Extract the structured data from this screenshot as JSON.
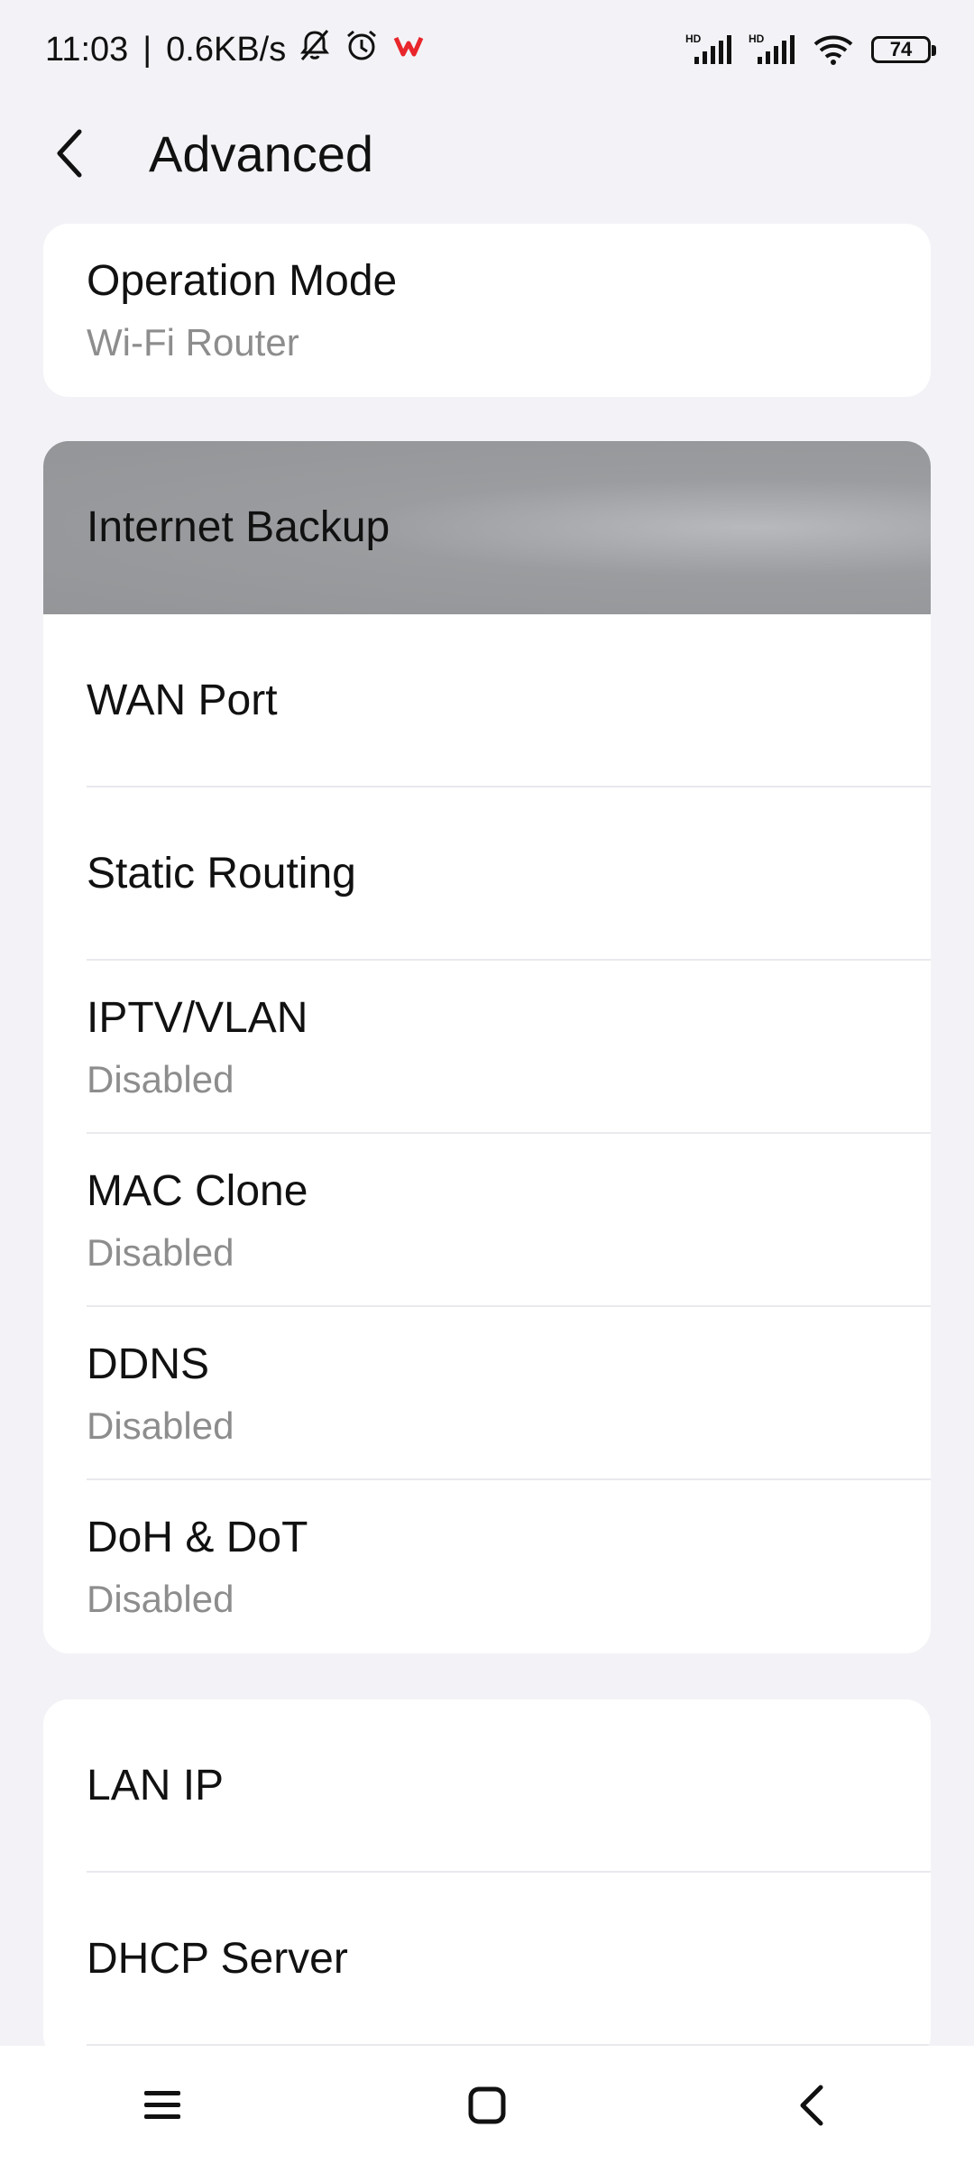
{
  "status_bar": {
    "time": "11:03",
    "separator": "|",
    "net_speed": "0.6KB/s",
    "battery_level": "74",
    "icons": [
      "mute-icon",
      "alarm-icon",
      "wps-app-icon",
      "hd-signal-icon",
      "hd-signal-icon",
      "wifi-icon",
      "battery-icon"
    ]
  },
  "header": {
    "title": "Advanced",
    "back_icon": "chevron-left-icon"
  },
  "cards": [
    {
      "items": [
        {
          "title": "Operation Mode",
          "subtitle": "Wi-Fi Router"
        }
      ]
    },
    {
      "items": [
        {
          "title": "Internet Backup",
          "pressed": true
        },
        {
          "title": "WAN Port"
        },
        {
          "title": "Static Routing"
        },
        {
          "title": "IPTV/VLAN",
          "subtitle": "Disabled"
        },
        {
          "title": "MAC Clone",
          "subtitle": "Disabled"
        },
        {
          "title": "DDNS",
          "subtitle": "Disabled"
        },
        {
          "title": "DoH & DoT",
          "subtitle": "Disabled"
        }
      ]
    },
    {
      "items": [
        {
          "title": "LAN IP"
        },
        {
          "title": "DHCP Server"
        }
      ]
    }
  ],
  "nav_bar": {
    "icons": [
      "menu-icon",
      "home-icon",
      "back-icon"
    ]
  },
  "colors": {
    "background": "#f3f3f7",
    "card": "#ffffff",
    "subtitle": "#8d8d8d",
    "pressed": "#95979a",
    "wps_red": "#e8262b"
  }
}
